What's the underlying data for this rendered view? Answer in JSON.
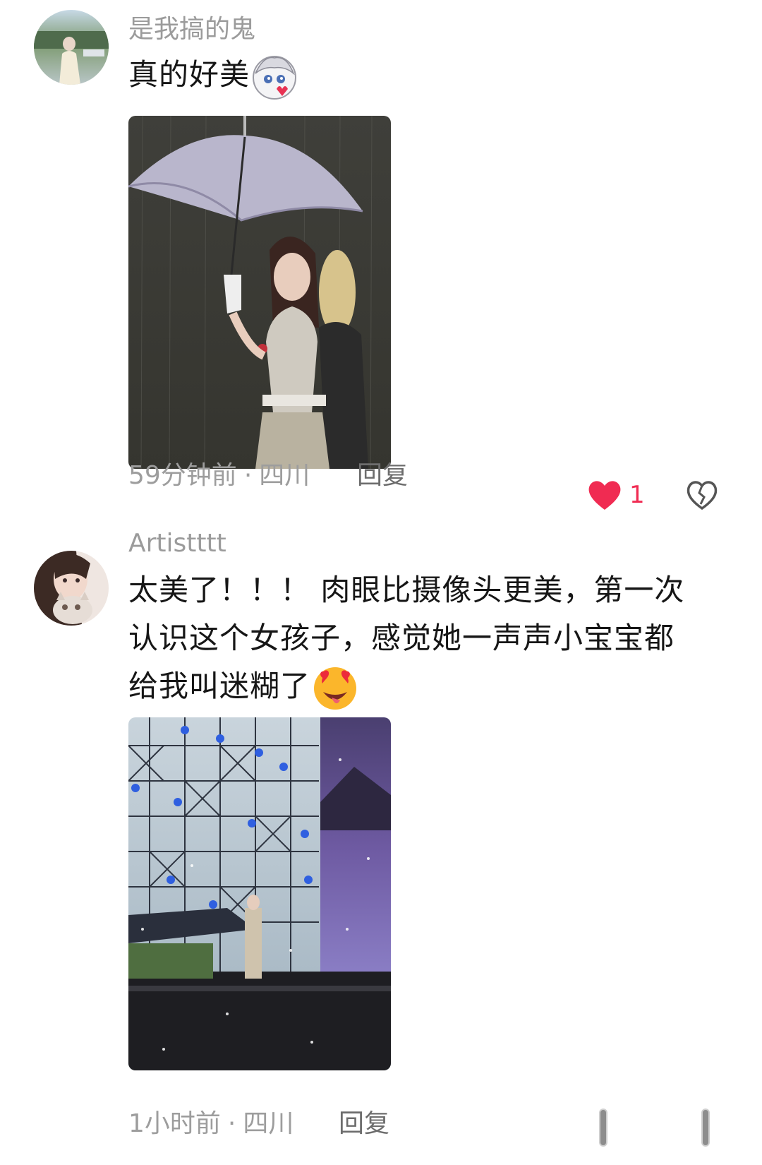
{
  "comments": [
    {
      "username": "是我搞的鬼",
      "text": "真的好美",
      "emoji": "cute-character-sticker",
      "photo": "woman-holding-umbrella-photo",
      "time": "59分钟前",
      "location": "四川",
      "reply_label": "回复",
      "likes": "1",
      "liked": true
    },
    {
      "username": "Artistttt",
      "text": "太美了！！！ 肉眼比摄像头更美，第一次认识这个女孩子，感觉她一声声小宝宝都给我叫迷糊了",
      "emoji": "heart-eyes-face",
      "photo": "concert-stage-photo",
      "time": "1小时前",
      "location": "四川",
      "reply_label": "回复"
    }
  ],
  "colors": {
    "like_red": "#f02b52",
    "meta_gray": "#9d9d9d",
    "username_gray": "#9b9b9b"
  },
  "icons": [
    "heart-filled-icon",
    "broken-heart-icon",
    "scroll-indicator-icon"
  ]
}
